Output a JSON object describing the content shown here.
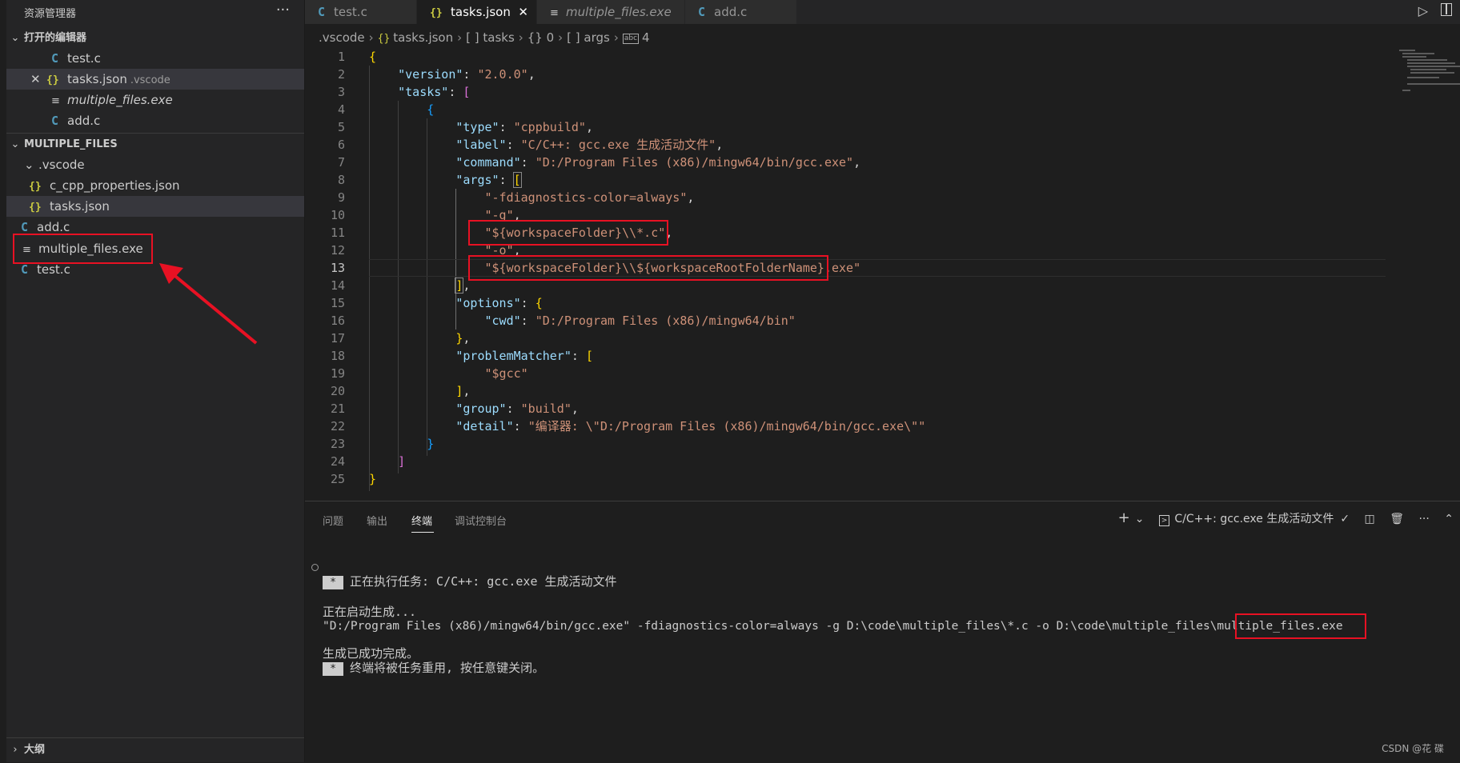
{
  "sidebar": {
    "title": "资源管理器",
    "more": "···",
    "open_editors": {
      "header": "打开的编辑器",
      "items": [
        {
          "icon": "C",
          "name": "test.c",
          "desc": ""
        },
        {
          "icon": "{}",
          "name": "tasks.json",
          "desc": ".vscode",
          "close": "✕"
        },
        {
          "icon": "≡",
          "name": "multiple_files.exe",
          "desc": ""
        },
        {
          "icon": "C",
          "name": "add.c",
          "desc": ""
        }
      ]
    },
    "workspace": {
      "header": "MULTIPLE_FILES",
      "folder": ".vscode",
      "items": [
        {
          "icon": "{}",
          "name": "c_cpp_properties.json"
        },
        {
          "icon": "{}",
          "name": "tasks.json"
        },
        {
          "icon": "C",
          "name": "add.c"
        },
        {
          "icon": "≡",
          "name": "multiple_files.exe"
        },
        {
          "icon": "C",
          "name": "test.c"
        }
      ]
    },
    "outline": "大纲"
  },
  "tabs": [
    {
      "icon": "C",
      "label": "test.c"
    },
    {
      "icon": "{}",
      "label": "tasks.json",
      "close": "✕"
    },
    {
      "icon": "≡",
      "label": "multiple_files.exe"
    },
    {
      "icon": "C",
      "label": "add.c"
    }
  ],
  "breadcrumb": {
    "b1": ".vscode",
    "b2_icon": "{}",
    "b2": "tasks.json",
    "b3": "[ ] tasks",
    "b4": "{} 0",
    "b5": "[ ] args",
    "b6_icon": "abc",
    "b6": "4"
  },
  "editor": {
    "line_numbers": [
      "1",
      "2",
      "3",
      "4",
      "5",
      "6",
      "7",
      "8",
      "9",
      "10",
      "11",
      "12",
      "13",
      "14",
      "15",
      "16",
      "17",
      "18",
      "19",
      "20",
      "21",
      "22",
      "23",
      "24",
      "25"
    ],
    "l2": {
      "key": "\"version\"",
      "val": "\"2.0.0\""
    },
    "l3": {
      "key": "\"tasks\""
    },
    "l5": {
      "key": "\"type\"",
      "val": "\"cppbuild\""
    },
    "l6": {
      "key": "\"label\"",
      "val": "\"C/C++: gcc.exe 生成活动文件\""
    },
    "l7": {
      "key": "\"command\"",
      "val": "\"D:/Program Files (x86)/mingw64/bin/gcc.exe\""
    },
    "l8": {
      "key": "\"args\""
    },
    "l9": "\"-fdiagnostics-color=always\"",
    "l10": "\"-g\"",
    "l11": "\"${workspaceFolder}\\\\*.c\"",
    "l12": "\"-o\"",
    "l13": "\"${workspaceFolder}\\\\${workspaceRootFolderName}.exe\"",
    "l15": {
      "key": "\"options\""
    },
    "l16": {
      "key": "\"cwd\"",
      "val": "\"D:/Program Files (x86)/mingw64/bin\""
    },
    "l18": {
      "key": "\"problemMatcher\""
    },
    "l19": "\"$gcc\"",
    "l21": {
      "key": "\"group\"",
      "val": "\"build\""
    },
    "l22": {
      "key": "\"detail\"",
      "val": "\"编译器: \\\"D:/Program Files (x86)/mingw64/bin/gcc.exe\\\"\""
    }
  },
  "panel": {
    "tabs": [
      "问题",
      "输出",
      "终端",
      "调试控制台"
    ],
    "task_name": "C/C++: gcc.exe 生成活动文件",
    "terminal": {
      "star": "*",
      "line1": "正在执行任务: C/C++: gcc.exe 生成活动文件",
      "line2": "正在启动生成...",
      "line3": "\"D:/Program Files (x86)/mingw64/bin/gcc.exe\" -fdiagnostics-color=always -g D:\\code\\multiple_files\\*.c -o D:\\code\\multiple_files",
      "line3_highlight": "\\multiple_files.exe",
      "line4": "生成已成功完成。",
      "line5": "终端将被任务重用, 按任意键关闭。"
    }
  },
  "watermark": "CSDN @花 碟"
}
